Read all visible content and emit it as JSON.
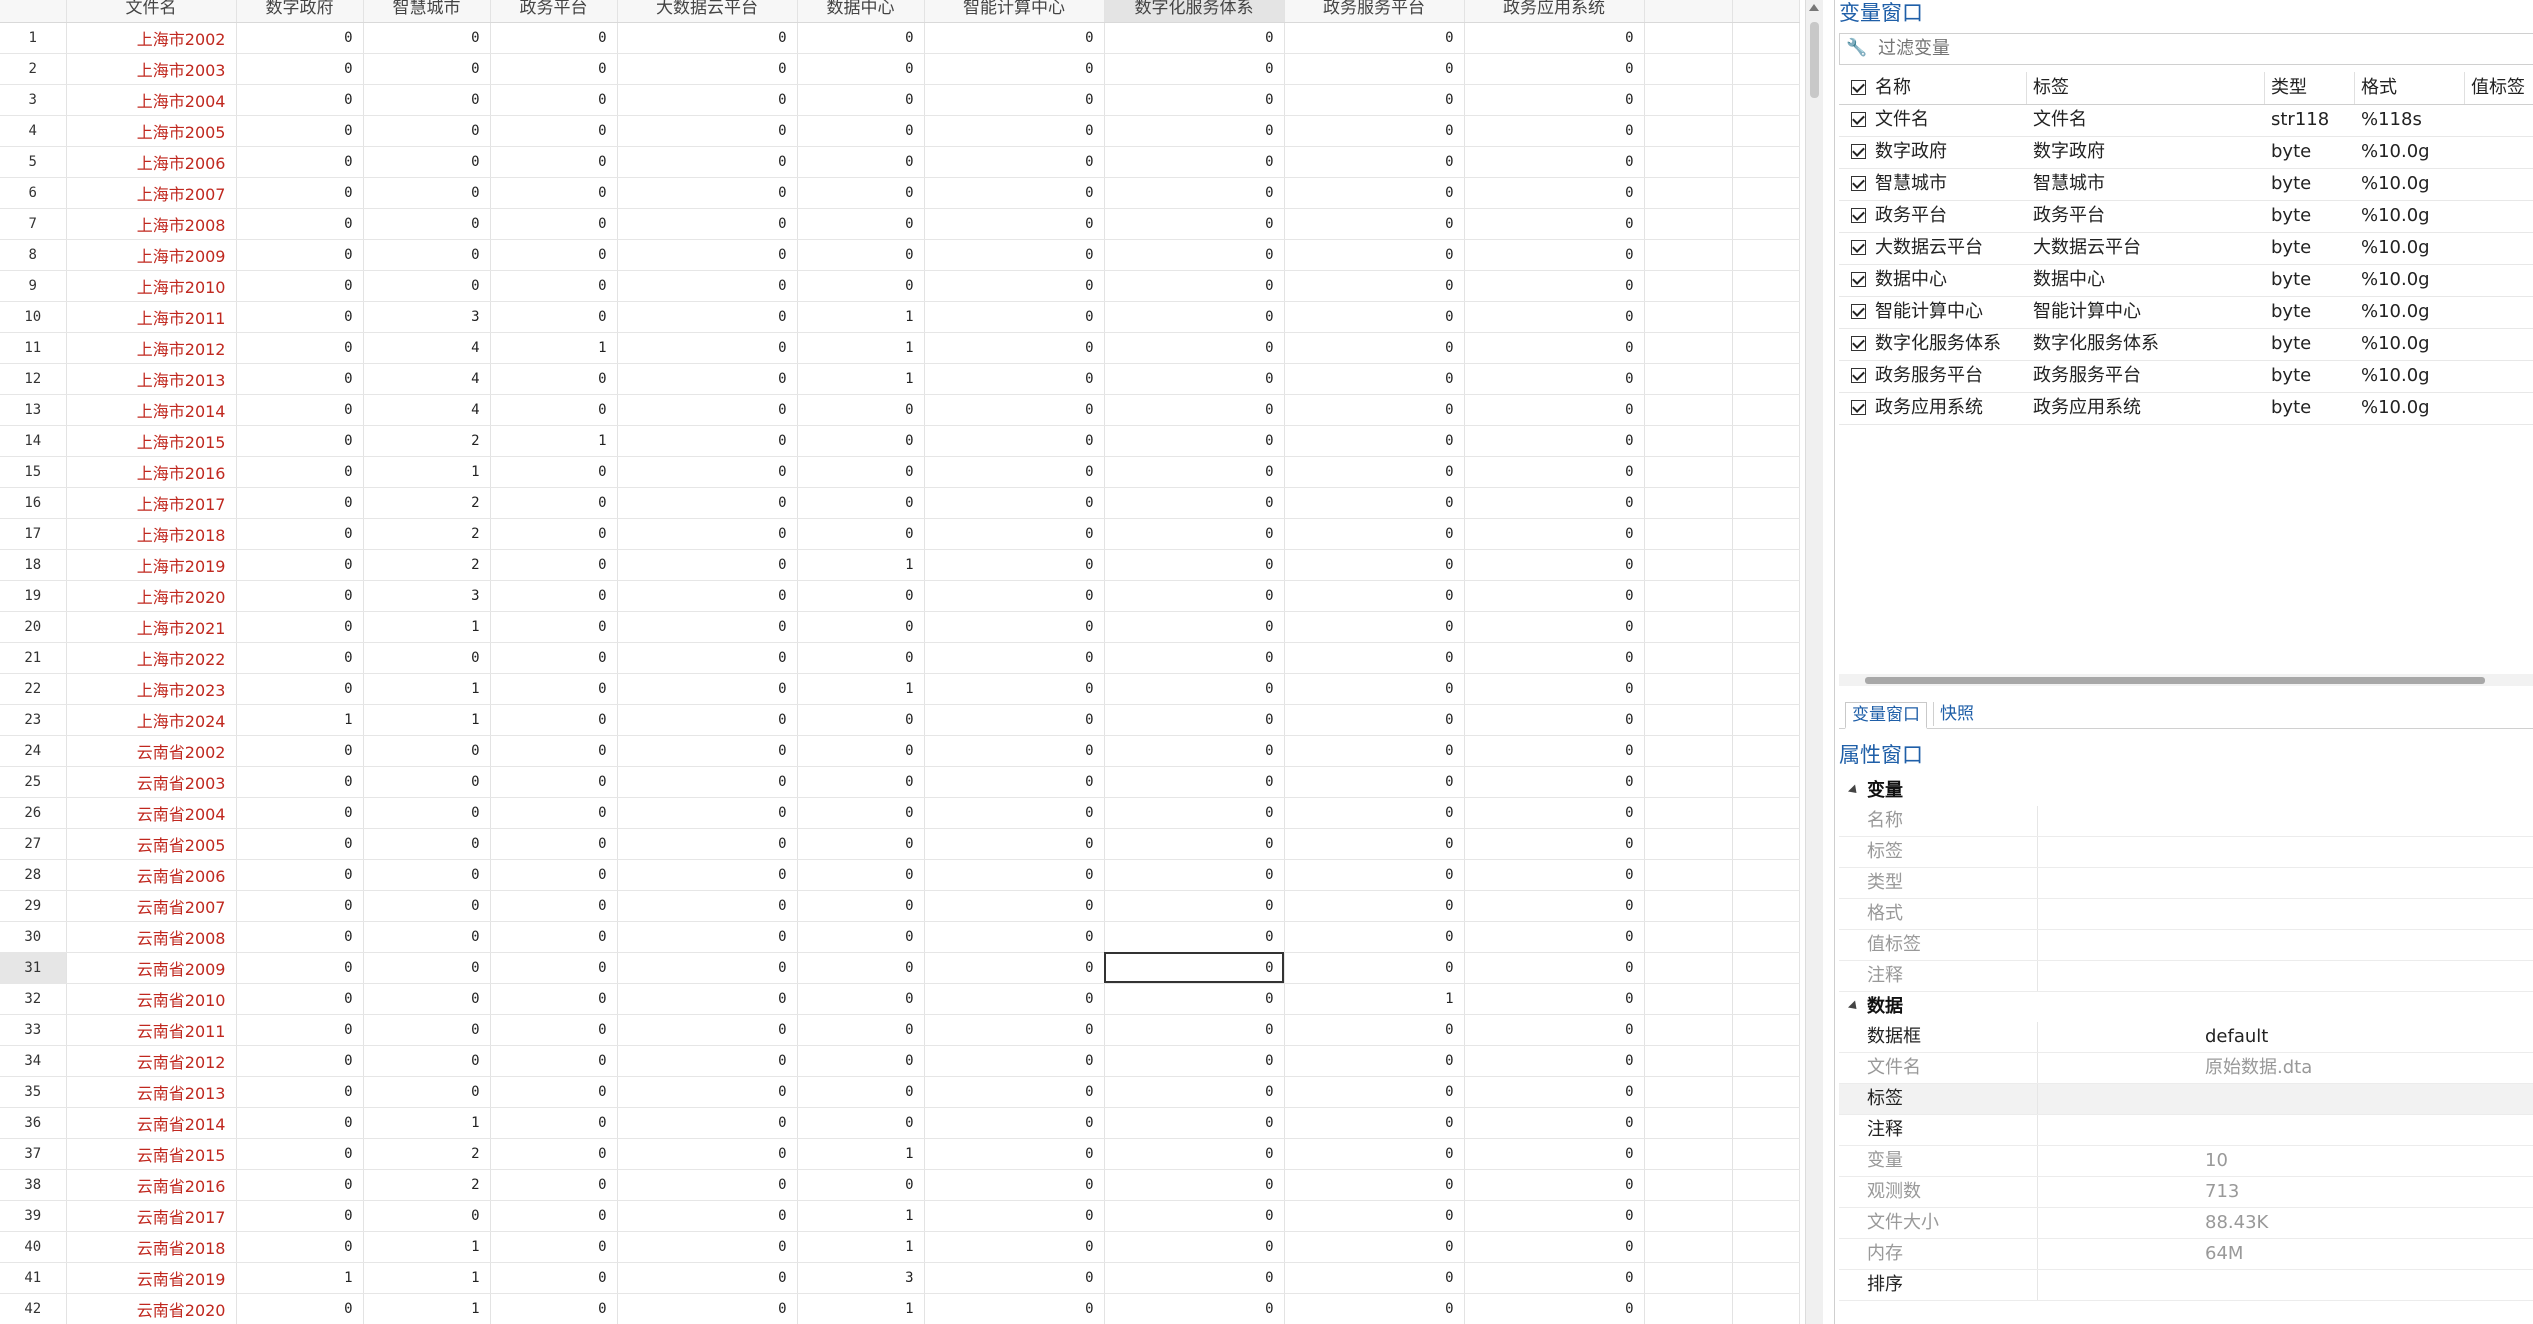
{
  "grid": {
    "columns": [
      "文件名",
      "数字政府",
      "智慧城市",
      "政务平台",
      "大数据云平台",
      "数据中心",
      "智能计算中心",
      "数字化服务体系",
      "政务服务平台",
      "政务应用系统"
    ],
    "highlighted_column": 7,
    "selected_row": 31,
    "selected_col": 7,
    "rows": [
      [
        "上海市2002",
        0,
        0,
        0,
        0,
        0,
        0,
        0,
        0,
        0
      ],
      [
        "上海市2003",
        0,
        0,
        0,
        0,
        0,
        0,
        0,
        0,
        0
      ],
      [
        "上海市2004",
        0,
        0,
        0,
        0,
        0,
        0,
        0,
        0,
        0
      ],
      [
        "上海市2005",
        0,
        0,
        0,
        0,
        0,
        0,
        0,
        0,
        0
      ],
      [
        "上海市2006",
        0,
        0,
        0,
        0,
        0,
        0,
        0,
        0,
        0
      ],
      [
        "上海市2007",
        0,
        0,
        0,
        0,
        0,
        0,
        0,
        0,
        0
      ],
      [
        "上海市2008",
        0,
        0,
        0,
        0,
        0,
        0,
        0,
        0,
        0
      ],
      [
        "上海市2009",
        0,
        0,
        0,
        0,
        0,
        0,
        0,
        0,
        0
      ],
      [
        "上海市2010",
        0,
        0,
        0,
        0,
        0,
        0,
        0,
        0,
        0
      ],
      [
        "上海市2011",
        0,
        3,
        0,
        0,
        1,
        0,
        0,
        0,
        0
      ],
      [
        "上海市2012",
        0,
        4,
        1,
        0,
        1,
        0,
        0,
        0,
        0
      ],
      [
        "上海市2013",
        0,
        4,
        0,
        0,
        1,
        0,
        0,
        0,
        0
      ],
      [
        "上海市2014",
        0,
        4,
        0,
        0,
        0,
        0,
        0,
        0,
        0
      ],
      [
        "上海市2015",
        0,
        2,
        1,
        0,
        0,
        0,
        0,
        0,
        0
      ],
      [
        "上海市2016",
        0,
        1,
        0,
        0,
        0,
        0,
        0,
        0,
        0
      ],
      [
        "上海市2017",
        0,
        2,
        0,
        0,
        0,
        0,
        0,
        0,
        0
      ],
      [
        "上海市2018",
        0,
        2,
        0,
        0,
        0,
        0,
        0,
        0,
        0
      ],
      [
        "上海市2019",
        0,
        2,
        0,
        0,
        1,
        0,
        0,
        0,
        0
      ],
      [
        "上海市2020",
        0,
        3,
        0,
        0,
        0,
        0,
        0,
        0,
        0
      ],
      [
        "上海市2021",
        0,
        1,
        0,
        0,
        0,
        0,
        0,
        0,
        0
      ],
      [
        "上海市2022",
        0,
        0,
        0,
        0,
        0,
        0,
        0,
        0,
        0
      ],
      [
        "上海市2023",
        0,
        1,
        0,
        0,
        1,
        0,
        0,
        0,
        0
      ],
      [
        "上海市2024",
        1,
        1,
        0,
        0,
        0,
        0,
        0,
        0,
        0
      ],
      [
        "云南省2002",
        0,
        0,
        0,
        0,
        0,
        0,
        0,
        0,
        0
      ],
      [
        "云南省2003",
        0,
        0,
        0,
        0,
        0,
        0,
        0,
        0,
        0
      ],
      [
        "云南省2004",
        0,
        0,
        0,
        0,
        0,
        0,
        0,
        0,
        0
      ],
      [
        "云南省2005",
        0,
        0,
        0,
        0,
        0,
        0,
        0,
        0,
        0
      ],
      [
        "云南省2006",
        0,
        0,
        0,
        0,
        0,
        0,
        0,
        0,
        0
      ],
      [
        "云南省2007",
        0,
        0,
        0,
        0,
        0,
        0,
        0,
        0,
        0
      ],
      [
        "云南省2008",
        0,
        0,
        0,
        0,
        0,
        0,
        0,
        0,
        0
      ],
      [
        "云南省2009",
        0,
        0,
        0,
        0,
        0,
        0,
        0,
        0,
        0
      ],
      [
        "云南省2010",
        0,
        0,
        0,
        0,
        0,
        0,
        0,
        1,
        0
      ],
      [
        "云南省2011",
        0,
        0,
        0,
        0,
        0,
        0,
        0,
        0,
        0
      ],
      [
        "云南省2012",
        0,
        0,
        0,
        0,
        0,
        0,
        0,
        0,
        0
      ],
      [
        "云南省2013",
        0,
        0,
        0,
        0,
        0,
        0,
        0,
        0,
        0
      ],
      [
        "云南省2014",
        0,
        1,
        0,
        0,
        0,
        0,
        0,
        0,
        0
      ],
      [
        "云南省2015",
        0,
        2,
        0,
        0,
        1,
        0,
        0,
        0,
        0
      ],
      [
        "云南省2016",
        0,
        2,
        0,
        0,
        0,
        0,
        0,
        0,
        0
      ],
      [
        "云南省2017",
        0,
        0,
        0,
        0,
        1,
        0,
        0,
        0,
        0
      ],
      [
        "云南省2018",
        0,
        1,
        0,
        0,
        1,
        0,
        0,
        0,
        0
      ],
      [
        "云南省2019",
        1,
        1,
        0,
        0,
        3,
        0,
        0,
        0,
        0
      ],
      [
        "云南省2020",
        0,
        1,
        0,
        0,
        1,
        0,
        0,
        0,
        0
      ]
    ]
  },
  "variables_panel": {
    "title": "变量窗口",
    "filter_placeholder": "过滤变量",
    "filter_icon": "wrench-icon",
    "headers": [
      "名称",
      "标签",
      "类型",
      "格式",
      "值标签"
    ],
    "variables": [
      {
        "name": "文件名",
        "label": "文件名",
        "type": "str118",
        "format": "%118s"
      },
      {
        "name": "数字政府",
        "label": "数字政府",
        "type": "byte",
        "format": "%10.0g"
      },
      {
        "name": "智慧城市",
        "label": "智慧城市",
        "type": "byte",
        "format": "%10.0g"
      },
      {
        "name": "政务平台",
        "label": "政务平台",
        "type": "byte",
        "format": "%10.0g"
      },
      {
        "name": "大数据云平台",
        "label": "大数据云平台",
        "type": "byte",
        "format": "%10.0g"
      },
      {
        "name": "数据中心",
        "label": "数据中心",
        "type": "byte",
        "format": "%10.0g"
      },
      {
        "name": "智能计算中心",
        "label": "智能计算中心",
        "type": "byte",
        "format": "%10.0g"
      },
      {
        "name": "数字化服务体系",
        "label": "数字化服务体系",
        "type": "byte",
        "format": "%10.0g"
      },
      {
        "name": "政务服务平台",
        "label": "政务服务平台",
        "type": "byte",
        "format": "%10.0g"
      },
      {
        "name": "政务应用系统",
        "label": "政务应用系统",
        "type": "byte",
        "format": "%10.0g"
      }
    ],
    "tabs": [
      "变量窗口",
      "快照"
    ]
  },
  "properties_panel": {
    "title": "属性窗口",
    "sections": [
      {
        "title": "变量",
        "rows": [
          {
            "key": "名称",
            "value": ""
          },
          {
            "key": "标签",
            "value": ""
          },
          {
            "key": "类型",
            "value": ""
          },
          {
            "key": "格式",
            "value": ""
          },
          {
            "key": "值标签",
            "value": ""
          },
          {
            "key": "注释",
            "value": ""
          }
        ]
      },
      {
        "title": "数据",
        "rows": [
          {
            "key": "数据框",
            "value": "default",
            "strong": true
          },
          {
            "key": "文件名",
            "value": "原始数据.dta"
          },
          {
            "key": "标签",
            "value": "",
            "strong": true,
            "shade": true
          },
          {
            "key": "注释",
            "value": "",
            "strong": true
          },
          {
            "key": "变量",
            "value": "10"
          },
          {
            "key": "观测数",
            "value": "713"
          },
          {
            "key": "文件大小",
            "value": "88.43K"
          },
          {
            "key": "内存",
            "value": "64M"
          },
          {
            "key": "排序",
            "value": "",
            "strong": true
          }
        ]
      }
    ]
  }
}
